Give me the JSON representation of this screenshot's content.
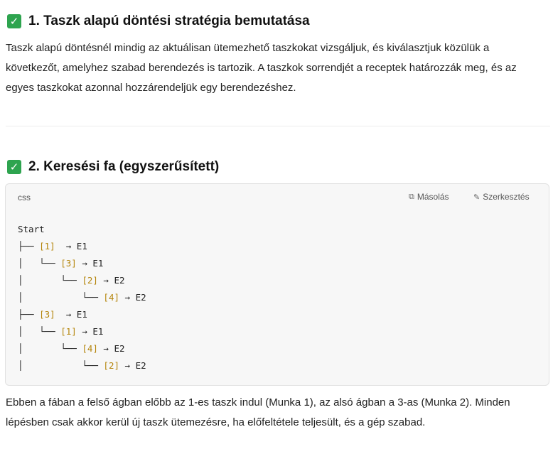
{
  "section1": {
    "check_icon": "✅",
    "title": "1. Taszk alapú döntési stratégia bemutatása",
    "text_l1": "Taszk alapú döntésnél mindig az aktuálisan ütemezhető taszkokat vizsgáljuk, és kiválasztjuk közülük a",
    "text_l2": "következőt, amelyhez szabad berendezés is tartozik. A taszkok sorrendjét a receptek határozzák meg, és az",
    "text_l3": "egyes taszkokat azonnal hozzárendeljük egy berendezéshez."
  },
  "section2": {
    "check_icon": "✅",
    "title": "2. Keresési fa (egyszerűsített)"
  },
  "code_block": {
    "language": "css",
    "copy_label": "Másolás",
    "edit_label": "Szerkesztés",
    "lines": [
      {
        "prefix": "Start",
        "num": "",
        "suffix": ""
      },
      {
        "prefix": "├── ",
        "num": "[1]",
        "suffix": "  → E1"
      },
      {
        "prefix": "│   └── ",
        "num": "[3]",
        "suffix": " → E1"
      },
      {
        "prefix": "│       └── ",
        "num": "[2]",
        "suffix": " → E2"
      },
      {
        "prefix": "│           └── ",
        "num": "[4]",
        "suffix": " → E2"
      },
      {
        "prefix": "├── ",
        "num": "[3]",
        "suffix": "  → E1"
      },
      {
        "prefix": "│   └── ",
        "num": "[1]",
        "suffix": " → E1"
      },
      {
        "prefix": "│       └── ",
        "num": "[4]",
        "suffix": " → E2"
      },
      {
        "prefix": "│           └── ",
        "num": "[2]",
        "suffix": " → E2"
      }
    ]
  },
  "footer": {
    "text_l1": "Ebben a fában a felső ágban előbb az 1-es taszk indul (Munka 1), az alsó ágban a 3-as (Munka 2). Minden",
    "text_l2": "lépésben csak akkor kerül új taszk ütemezésre, ha előfeltétele teljesült, és a gép szabad."
  },
  "colors": {
    "check_green": "#2ea44f",
    "code_number": "#b5860d",
    "code_background": "#f7f7f7"
  }
}
